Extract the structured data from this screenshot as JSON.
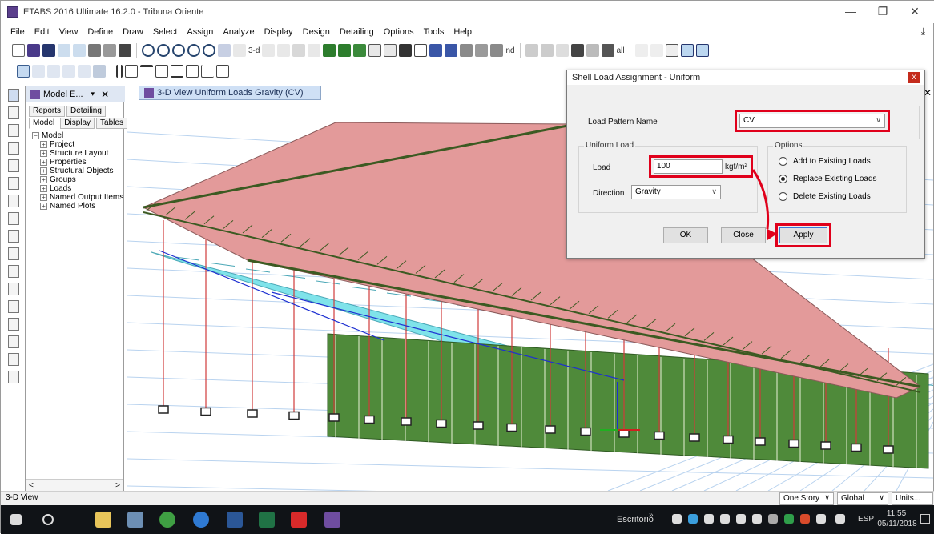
{
  "window": {
    "title": "ETABS 2016 Ultimate 16.2.0 - Tribuna Oriente",
    "minimize": "—",
    "restore": "❐",
    "close": "✕"
  },
  "menu": [
    "File",
    "Edit",
    "View",
    "Define",
    "Draw",
    "Select",
    "Assign",
    "Analyze",
    "Display",
    "Design",
    "Detailing",
    "Options",
    "Tools",
    "Help"
  ],
  "toolbar": {
    "text_3d": "3-d",
    "text_nd": "nd",
    "text_all": "all"
  },
  "model_panel": {
    "tab_label": "Model E...",
    "pin": "▾",
    "close": "✕",
    "subtabs_row1": [
      "Reports",
      "Detailing"
    ],
    "subtabs_row2": [
      "Model",
      "Display",
      "Tables"
    ],
    "tree_root": "Model",
    "tree_children": [
      "Project",
      "Structure Layout",
      "Properties",
      "Structural Objects",
      "Groups",
      "Loads",
      "Named Output Items",
      "Named Plots"
    ],
    "collapse_glyph": "−",
    "expand_glyph": "+",
    "scroll_left": "<",
    "scroll_right": ">"
  },
  "document_tab": {
    "label": "3-D View  Uniform Loads Gravity  (CV)",
    "close": "✕"
  },
  "dialog": {
    "title": "Shell Load Assignment - Uniform",
    "close": "x",
    "load_pattern_label": "Load Pattern Name",
    "load_pattern_value": "CV",
    "uniform_group": "Uniform Load",
    "load_label": "Load",
    "load_value": "100",
    "load_unit": "kgf/m²",
    "direction_label": "Direction",
    "direction_value": "Gravity",
    "options_group": "Options",
    "options": [
      {
        "label": "Add to Existing Loads",
        "checked": false
      },
      {
        "label": "Replace Existing Loads",
        "checked": true
      },
      {
        "label": "Delete Existing Loads",
        "checked": false
      }
    ],
    "ok": "OK",
    "close_btn": "Close",
    "apply": "Apply",
    "highlight_color": "#e0001b"
  },
  "status": {
    "text": "3-D View",
    "story": "One Story",
    "coords": "Global",
    "units": "Units..."
  },
  "taskbar": {
    "desktop": "Escritorio",
    "chevron": "»",
    "lang": "ESP",
    "time": "11:55",
    "date": "05/11/2018"
  },
  "colors": {
    "roof": "#e39a9a",
    "deck": "#7fe3ea",
    "walls": "#4f8a3a",
    "truss": "#3c5a22",
    "columns": "#d03b3b",
    "bracing": "#1d2fd1"
  }
}
